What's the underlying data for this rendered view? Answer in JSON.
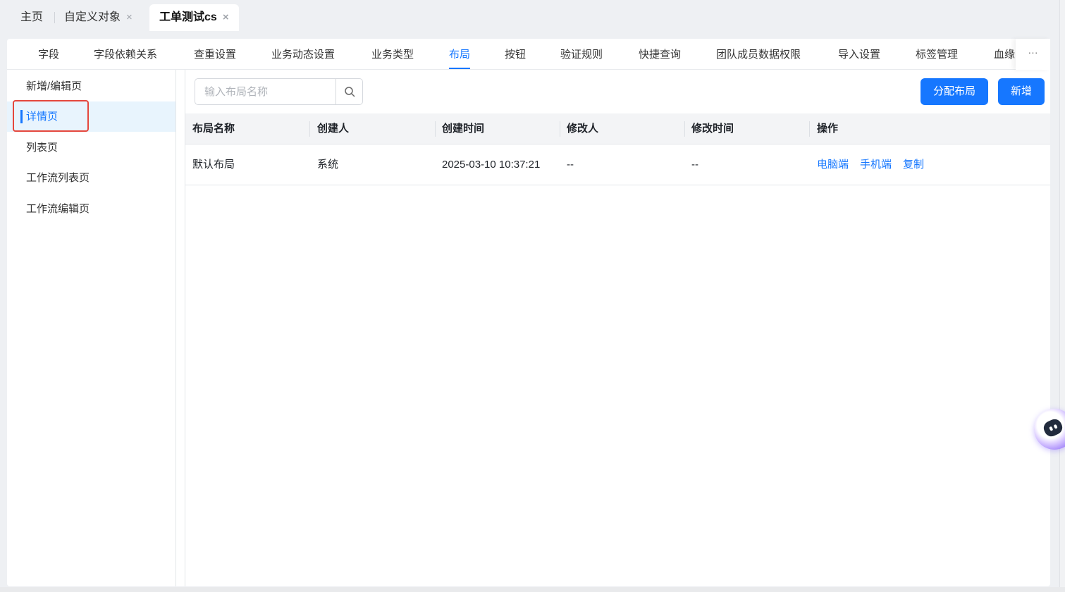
{
  "top_tabs": [
    {
      "label": "主页",
      "closable": false
    },
    {
      "label": "自定义对象",
      "closable": true
    },
    {
      "label": "工单测试cs",
      "closable": true,
      "active": true
    }
  ],
  "close_glyph": "×",
  "sub_tabs": [
    "字段",
    "字段依赖关系",
    "查重设置",
    "业务动态设置",
    "业务类型",
    "布局",
    "按钮",
    "验证规则",
    "快捷查询",
    "团队成员数据权限",
    "导入设置",
    "标签管理",
    "血缘"
  ],
  "sub_tabs_active": "布局",
  "more_label": "···",
  "side_menu": [
    {
      "label": "新增/编辑页"
    },
    {
      "label": "详情页",
      "active": true
    },
    {
      "label": "列表页"
    },
    {
      "label": "工作流列表页"
    },
    {
      "label": "工作流编辑页"
    }
  ],
  "search": {
    "placeholder": "输入布局名称",
    "icon": "search-icon"
  },
  "buttons": {
    "assign": "分配布局",
    "add": "新增"
  },
  "table": {
    "columns": [
      "布局名称",
      "创建人",
      "创建时间",
      "修改人",
      "修改时间",
      "操作"
    ],
    "rows": [
      {
        "name": "默认布局",
        "creator": "系统",
        "created": "2025-03-10 10:37:21",
        "modifier": "--",
        "modified": "--",
        "actions": [
          "电脑端",
          "手机端",
          "复制"
        ]
      }
    ]
  },
  "colors": {
    "accent": "#1677ff",
    "highlight": "#e5473d",
    "active_bg": "#e8f4fd"
  }
}
